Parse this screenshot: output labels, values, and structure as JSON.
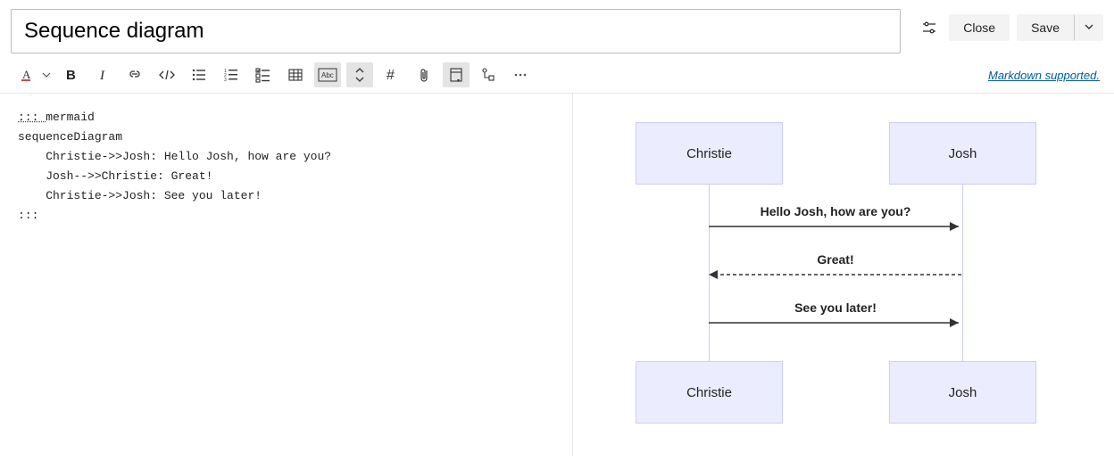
{
  "header": {
    "title": "Sequence diagram",
    "close_label": "Close",
    "save_label": "Save"
  },
  "toolbar": {
    "markdown_link": "Markdown supported."
  },
  "editor": {
    "line1_prefix": "::: ",
    "line1_word": "mermaid",
    "line2": "sequenceDiagram",
    "line3": "    Christie->>Josh: Hello Josh, how are you?",
    "line4": "    Josh-->>Christie: Great!",
    "line5": "    Christie->>Josh: See you later!",
    "line6": ":::"
  },
  "diagram": {
    "actor1": "Christie",
    "actor2": "Josh",
    "msg1": "Hello Josh, how are you?",
    "msg2": "Great!",
    "msg3": "See you later!"
  }
}
